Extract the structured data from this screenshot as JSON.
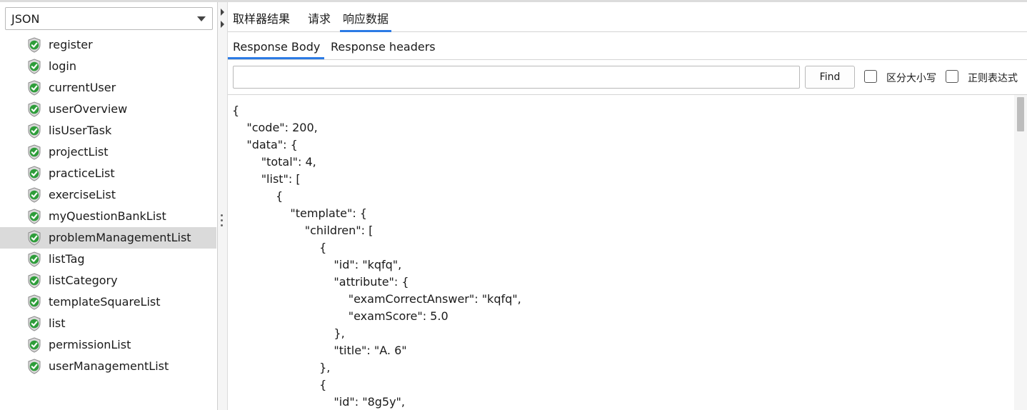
{
  "left_panel": {
    "renderer_select": {
      "value": "JSON"
    },
    "samples": [
      {
        "label": "register",
        "status": "success"
      },
      {
        "label": "login",
        "status": "success"
      },
      {
        "label": "currentUser",
        "status": "success"
      },
      {
        "label": "userOverview",
        "status": "success"
      },
      {
        "label": "lisUserTask",
        "status": "success"
      },
      {
        "label": "projectList",
        "status": "success"
      },
      {
        "label": "practiceList",
        "status": "success"
      },
      {
        "label": "exerciseList",
        "status": "success"
      },
      {
        "label": " myQuestionBankList",
        "status": "success"
      },
      {
        "label": "problemManagementList",
        "status": "success",
        "selected": true
      },
      {
        "label": "listTag",
        "status": "success"
      },
      {
        "label": "listCategory",
        "status": "success"
      },
      {
        "label": "templateSquareList",
        "status": "success"
      },
      {
        "label": "list",
        "status": "success"
      },
      {
        "label": "permissionList",
        "status": "success"
      },
      {
        "label": "userManagementList",
        "status": "success"
      }
    ]
  },
  "tabs": [
    {
      "label": "取样器结果"
    },
    {
      "label": "请求"
    },
    {
      "label": "响应数据",
      "active": true
    }
  ],
  "subtabs": [
    {
      "label": "Response Body",
      "active": true
    },
    {
      "label": "Response headers"
    }
  ],
  "find": {
    "input_value": "",
    "button_label": "Find",
    "case_sensitive_label": "区分大小写",
    "regex_label": "正则表达式"
  },
  "response_lines": [
    "{",
    "    \"code\": 200,",
    "    \"data\": {",
    "        \"total\": 4,",
    "        \"list\": [",
    "            {",
    "                \"template\": {",
    "                    \"children\": [",
    "                        {",
    "                            \"id\": \"kqfq\",",
    "                            \"attribute\": {",
    "                                \"examCorrectAnswer\": \"kqfq\",",
    "                                \"examScore\": 5.0",
    "                            },",
    "                            \"title\": \"A. 6\"",
    "                        },",
    "                        {",
    "                            \"id\": \"8g5y\","
  ],
  "colors": {
    "accent": "#2c7be5",
    "success_green": "#2e9d3a",
    "selected_row": "#dadada"
  },
  "icons": {
    "sample_status": "shield-check-icon"
  }
}
